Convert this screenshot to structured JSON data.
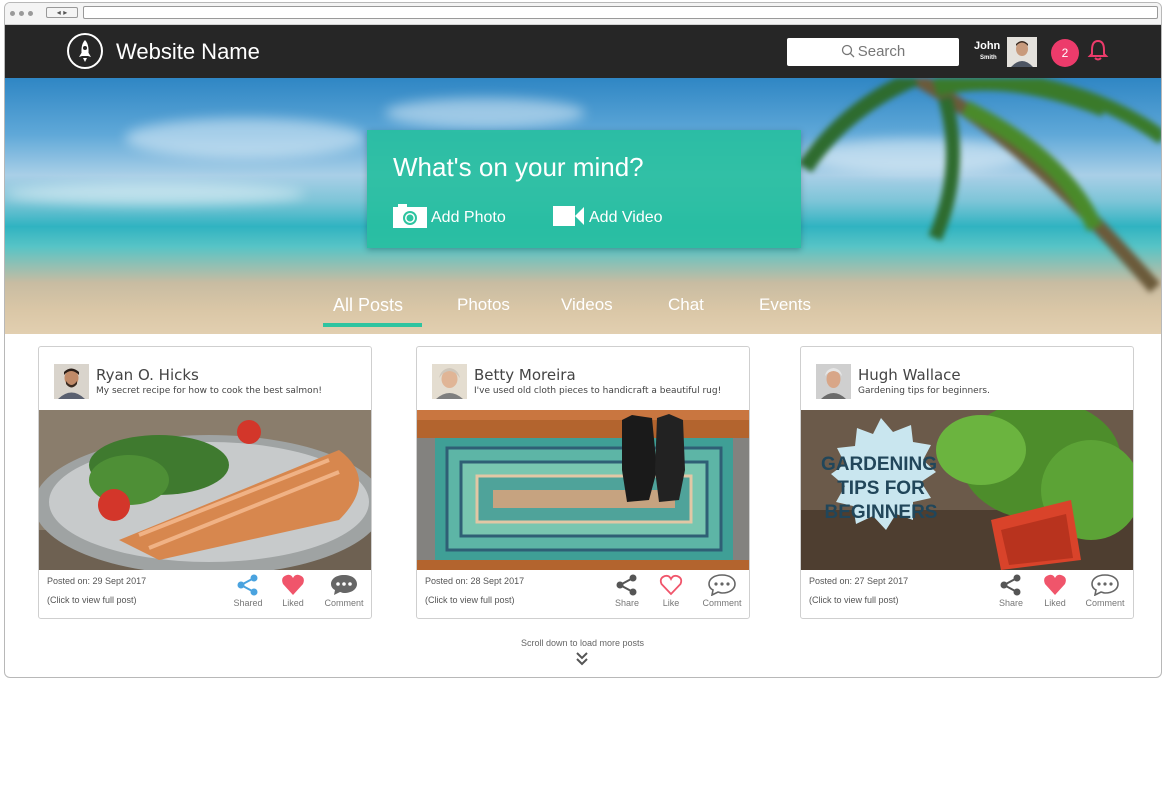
{
  "header": {
    "site_name": "Website Name",
    "search_placeholder": "Search",
    "user_first": "John",
    "user_last": "Smith",
    "notification_count": "2"
  },
  "hero": {
    "prompt": "What's on your mind?",
    "add_photo": "Add Photo",
    "add_video": "Add Video"
  },
  "tabs": [
    {
      "label": "All Posts",
      "active": true
    },
    {
      "label": "Photos"
    },
    {
      "label": "Videos"
    },
    {
      "label": "Chat"
    },
    {
      "label": "Events"
    }
  ],
  "posts": [
    {
      "author": "Ryan O. Hicks",
      "description": "My secret recipe for how to cook the best salmon!",
      "posted": "Posted on: 29 Sept 2017",
      "view_full": "(Click to view full post)",
      "share_label": "Shared",
      "like_label": "Liked",
      "comment_label": "Comment",
      "image": "salmon-dish"
    },
    {
      "author": "Betty Moreira",
      "description": "I've used old cloth pieces to handicraft a beautiful rug!",
      "posted": "Posted on: 28 Sept 2017",
      "view_full": "(Click to view full post)",
      "share_label": "Share",
      "like_label": "Like",
      "comment_label": "Comment",
      "image": "rag-rug-with-boots"
    },
    {
      "author": "Hugh Wallace",
      "description": "Gardening tips for beginners.",
      "posted": "Posted on: 27 Sept 2017",
      "view_full": "(Click to view full post)",
      "share_label": "Share",
      "like_label": "Liked",
      "comment_label": "Comment",
      "image": "basil-seedlings",
      "image_text": [
        "GARDENING",
        "TIPS FOR",
        "BEGINNERS"
      ]
    }
  ],
  "footer": {
    "scroll_hint": "Scroll down to load more posts"
  },
  "colors": {
    "topbar": "#262626",
    "accent": "#2ec4a0",
    "badge": "#ec3b6b",
    "share_active": "#4aa3df",
    "like_active": "#f0556b"
  },
  "icons": [
    "rocket-icon",
    "search-icon",
    "bell-icon",
    "camera-icon",
    "video-camera-icon",
    "share-icon",
    "heart-icon",
    "comment-icon",
    "double-chevron-down-icon"
  ]
}
